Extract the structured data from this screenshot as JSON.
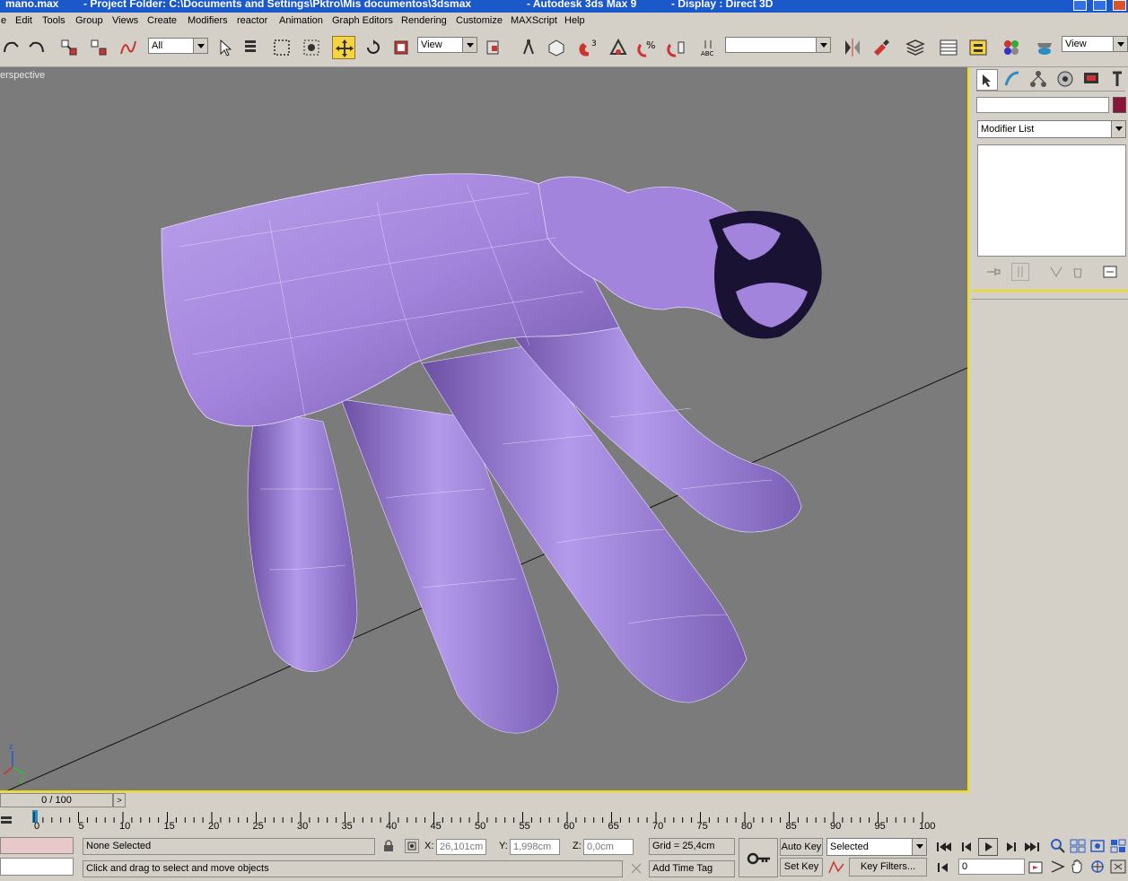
{
  "title": {
    "file": "mano.max",
    "project": "- Project Folder: C:\\Documents and Settings\\Pktro\\Mis documentos\\3dsmax",
    "app": "- Autodesk 3ds Max 9",
    "display": "- Display : Direct 3D"
  },
  "menu": [
    "e",
    "Edit",
    "Tools",
    "Group",
    "Views",
    "Create",
    "Modifiers",
    "reactor",
    "Animation",
    "Graph Editors",
    "Rendering",
    "Customize",
    "MAXScript",
    "Help"
  ],
  "toolbar": {
    "selection_filter": "All",
    "ref_coord": "View",
    "named_selection": "",
    "right_combo": "View"
  },
  "viewport": {
    "label": "erspective"
  },
  "command_panel": {
    "object_name": "",
    "object_color": "#8b1538",
    "modifier_list": "Modifier List"
  },
  "time": {
    "slider_label": "0 / 100",
    "ticks": [
      "0",
      "5",
      "10",
      "15",
      "20",
      "25",
      "30",
      "35",
      "40",
      "45",
      "50",
      "55",
      "60",
      "65",
      "70",
      "75",
      "80",
      "85",
      "90",
      "95",
      "100"
    ]
  },
  "status": {
    "selection": "None Selected",
    "prompt": "Click and drag to select and move objects",
    "x_label": "X:",
    "x_value": "26,101cm",
    "y_label": "Y:",
    "y_value": "1,998cm",
    "z_label": "Z:",
    "z_value": "0,0cm",
    "grid": "Grid = 25,4cm",
    "add_time_tag": "Add Time Tag",
    "auto_key": "Auto Key",
    "set_key": "Set Key",
    "key_mode": "Selected",
    "key_filters": "Key Filters...",
    "frame": "0"
  },
  "colors": {
    "title_bar": "#1b58c9",
    "viewport_bg": "#7b7b7b",
    "mesh": "#a78bd9",
    "active_border": "#f0e000"
  }
}
